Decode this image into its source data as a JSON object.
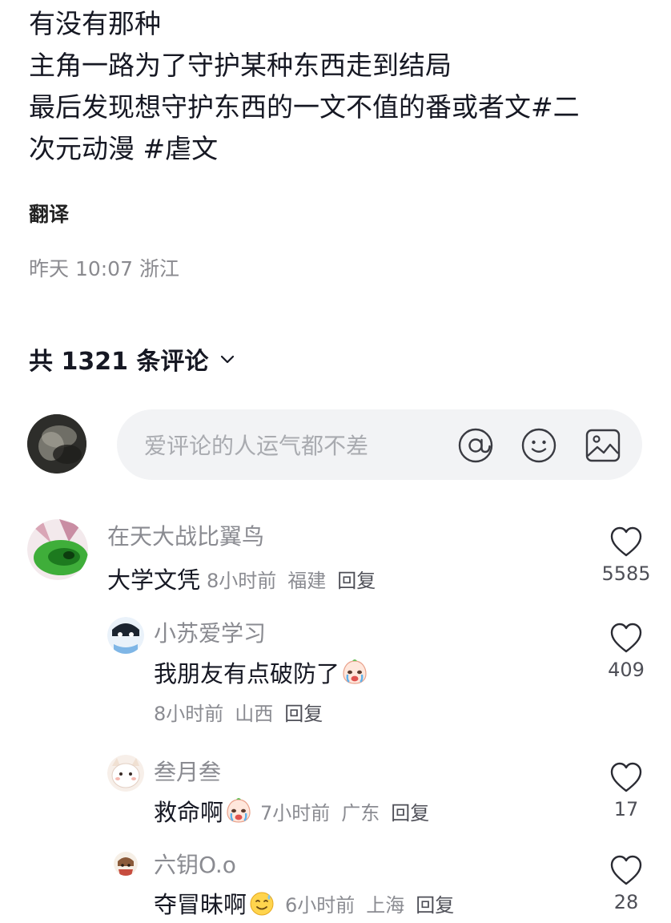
{
  "post": {
    "lines": [
      "有没有那种",
      "主角一路为了守护某种东西走到结局",
      "最后发现想守护东西的一文不值的番或者文#二",
      "次元动漫 #虐文"
    ],
    "translate_label": "翻译",
    "meta": "昨天 10:07 浙江"
  },
  "comments_header": {
    "count_label": "共 1321 条评论"
  },
  "input": {
    "placeholder": "爱评论的人运气都不差",
    "icons": [
      "at-icon",
      "emoji-icon",
      "image-icon"
    ]
  },
  "comments": [
    {
      "user": "在天大战比翼鸟",
      "text": "大学文凭",
      "time": "8小时前",
      "location": "福建",
      "reply": "回复",
      "likes": "5585"
    },
    {
      "user": "小苏爱学习",
      "text": "我朋友有点破防了",
      "emoji": "crying-emoji",
      "time": "8小时前",
      "location": "山西",
      "reply": "回复",
      "likes": "409"
    },
    {
      "user": "叁月叁",
      "text": "救命啊",
      "emoji": "crying-emoji",
      "time": "7小时前",
      "location": "广东",
      "reply": "回复",
      "likes": "17"
    },
    {
      "user": "六钥O.o",
      "text": "夺冒昧啊",
      "emoji": "sweat-smile-emoji",
      "time": "6小时前",
      "location": "上海",
      "reply": "回复",
      "likes": "28"
    }
  ],
  "colors": {
    "primary_text": "#161823",
    "secondary_text": "#8a8b91",
    "input_bg": "#f2f3f5"
  }
}
